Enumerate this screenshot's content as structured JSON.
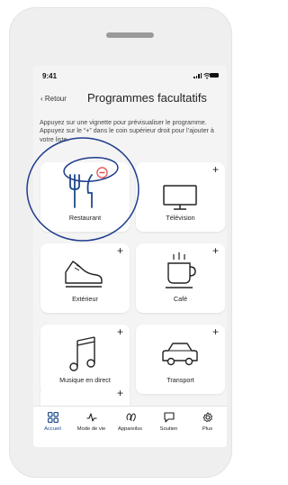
{
  "status_bar": {
    "time": "9:41"
  },
  "header": {
    "back_label": "Retour",
    "title": "Programmes facultatifs"
  },
  "description": "Appuyez sur une vignette pour prévisualiser le programme. Appuyez sur le “+” dans le coin supérieur droit pour l’ajouter à votre liste.",
  "programs": [
    {
      "label": "Restaurant",
      "icon": "restaurant-icon",
      "state": "added"
    },
    {
      "label": "Télévision",
      "icon": "tv-icon",
      "state": "available"
    },
    {
      "label": "Extérieur",
      "icon": "shoe-icon",
      "state": "available"
    },
    {
      "label": "Café",
      "icon": "coffee-cup-icon",
      "state": "available"
    },
    {
      "label": "Musique en direct",
      "icon": "music-note-icon",
      "state": "available"
    },
    {
      "label": "Transport",
      "icon": "car-icon",
      "state": "available"
    },
    {
      "label": "",
      "icon": "",
      "state": "available"
    }
  ],
  "add_symbol": "+",
  "tab_bar": [
    {
      "label": "Accueil",
      "icon": "grid-icon",
      "active": true
    },
    {
      "label": "Mode de vie",
      "icon": "activity-icon",
      "active": false
    },
    {
      "label": "Appareilss",
      "icon": "hearing-aids-icon",
      "active": false
    },
    {
      "label": "Soutien",
      "icon": "chat-icon",
      "active": false
    },
    {
      "label": "Plus",
      "icon": "gear-icon",
      "active": false
    }
  ],
  "colors": {
    "accent": "#1e4a8a",
    "remove": "#e0464a",
    "annotation": "#1f3d8c"
  }
}
